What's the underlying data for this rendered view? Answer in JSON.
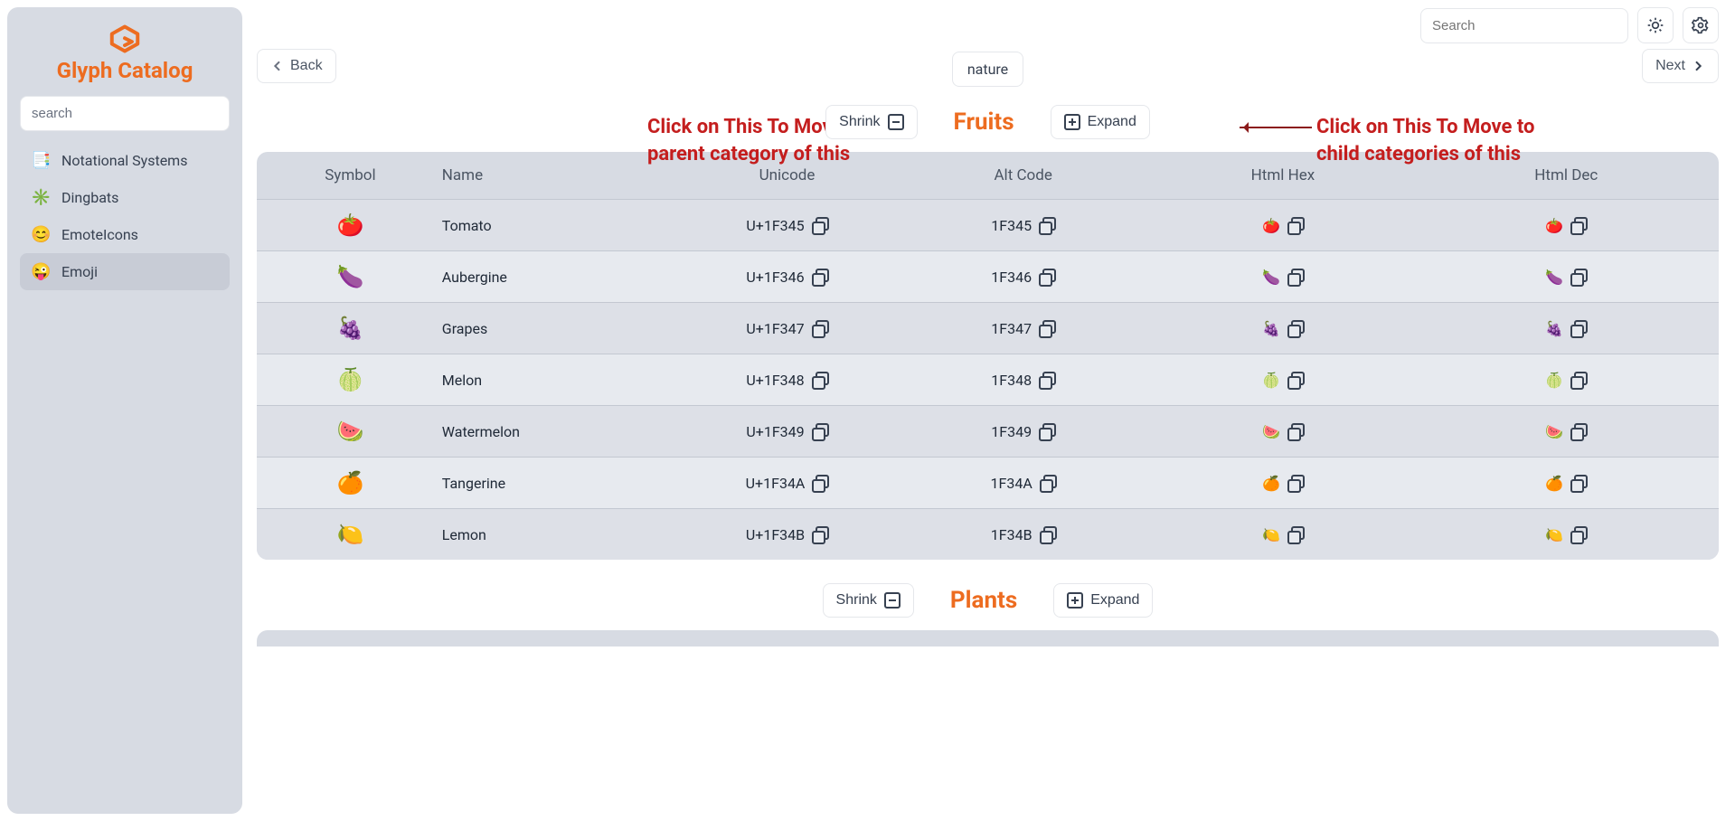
{
  "brand": {
    "title": "Glyph Catalog"
  },
  "sidebar": {
    "search_placeholder": "search",
    "items": [
      {
        "icon": "📑",
        "label": "Notational Systems",
        "active": false
      },
      {
        "icon": "✳️",
        "label": "Dingbats",
        "active": false
      },
      {
        "icon": "😊",
        "label": "EmoteIcons",
        "active": false
      },
      {
        "icon": "😜",
        "label": "Emoji",
        "active": true
      }
    ]
  },
  "topbar": {
    "search_placeholder": "Search"
  },
  "nav": {
    "back": "Back",
    "next": "Next",
    "breadcrumb": "nature"
  },
  "controls": {
    "shrink": "Shrink",
    "expand": "Expand"
  },
  "annotations": {
    "left": "Click on This To Move back to parent category of this",
    "right": "Click on This To Move to child categories of this"
  },
  "columns": [
    "Symbol",
    "Name",
    "Unicode",
    "Alt Code",
    "Html Hex",
    "Html Dec"
  ],
  "sections": [
    {
      "title": "Fruits",
      "rows": [
        {
          "sym": "🍅",
          "name": "Tomato",
          "unicode": "U+1F345",
          "alt": "1F345",
          "hex": "&#x1F345",
          "dec": "&#127813"
        },
        {
          "sym": "🍆",
          "name": "Aubergine",
          "unicode": "U+1F346",
          "alt": "1F346",
          "hex": "&#x1F346",
          "dec": "&#127814"
        },
        {
          "sym": "🍇",
          "name": "Grapes",
          "unicode": "U+1F347",
          "alt": "1F347",
          "hex": "&#x1F347",
          "dec": "&#127815"
        },
        {
          "sym": "🍈",
          "name": "Melon",
          "unicode": "U+1F348",
          "alt": "1F348",
          "hex": "&#x1F348",
          "dec": "&#127816"
        },
        {
          "sym": "🍉",
          "name": "Watermelon",
          "unicode": "U+1F349",
          "alt": "1F349",
          "hex": "&#x1F349",
          "dec": "&#127817"
        },
        {
          "sym": "🍊",
          "name": "Tangerine",
          "unicode": "U+1F34A",
          "alt": "1F34A",
          "hex": "&#x1F34A",
          "dec": "&#127818"
        },
        {
          "sym": "🍋",
          "name": "Lemon",
          "unicode": "U+1F34B",
          "alt": "1F34B",
          "hex": "&#x1F34B",
          "dec": "&#127819"
        }
      ]
    },
    {
      "title": "Plants",
      "rows": []
    }
  ]
}
